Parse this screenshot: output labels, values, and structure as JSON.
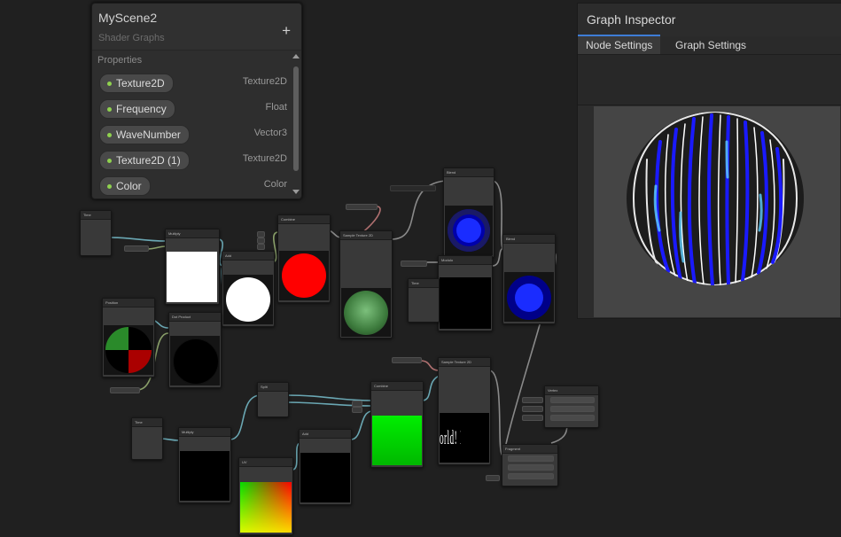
{
  "blackboard": {
    "title": "MyScene2",
    "subtitle": "Shader Graphs",
    "add_label": "+",
    "section": "Properties",
    "properties": [
      {
        "name": "Texture2D",
        "type": "Texture2D"
      },
      {
        "name": "Frequency",
        "type": "Float"
      },
      {
        "name": "WaveNumber",
        "type": "Vector3"
      },
      {
        "name": "Texture2D (1)",
        "type": "Texture2D"
      },
      {
        "name": "Color",
        "type": "Color"
      }
    ]
  },
  "inspector": {
    "title": "Graph Inspector",
    "tabs": [
      "Node Settings",
      "Graph Settings"
    ],
    "active_tab": "Node Settings"
  },
  "graph": {
    "text_preview": "orld! Hello W",
    "nodes": [
      "Time",
      "Multiply",
      "Add",
      "Combine",
      "Sample Texture 2D",
      "Blend",
      "Modulo",
      "Position",
      "Dot Product",
      "Split",
      "Combine",
      "Sample Texture 2D",
      "UV",
      "Add",
      "Multiply",
      "Time",
      "Blend",
      "Vertex",
      "Fragment"
    ]
  },
  "colors": {
    "canvas": "#202020",
    "accent_tab": "#3e7dd6",
    "property_dot": "#8fd14f"
  }
}
